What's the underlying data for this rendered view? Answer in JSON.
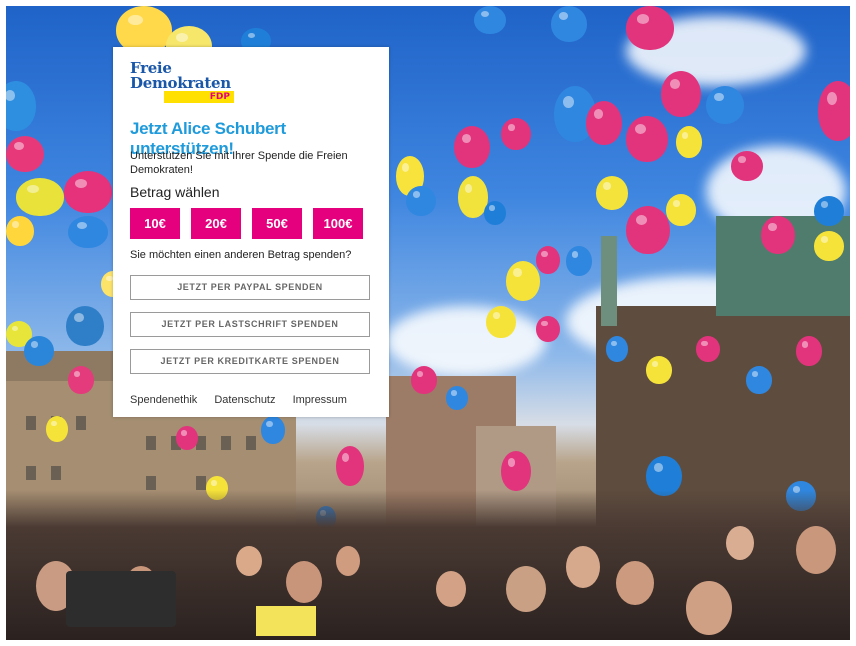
{
  "logo": {
    "line1": "Freie",
    "line2": "Demokraten",
    "badge": "FDP"
  },
  "headline": "Jetzt Alice Schubert unterstützen!",
  "intro": "Unterstützen Sie mit Ihrer Spende die Freien Demokraten!",
  "amount_title": "Betrag wählen",
  "amounts": [
    "10€",
    "20€",
    "50€",
    "100€"
  ],
  "other_amount": "Sie möchten einen anderen Betrag spenden?",
  "payment_buttons": {
    "paypal": "JETZT PER PAYPAL SPENDEN",
    "lastschrift": "JETZT PER LASTSCHRIFT SPENDEN",
    "kreditkarte": "JETZT PER KREDITKARTE SPENDEN"
  },
  "footer": [
    "Spendenethik",
    "Datenschutz",
    "Impressum"
  ],
  "colors": {
    "brand_blue": "#1a57a9",
    "headline_blue": "#1f9bdb",
    "magenta": "#e5007d",
    "yellow": "#ffe000"
  }
}
